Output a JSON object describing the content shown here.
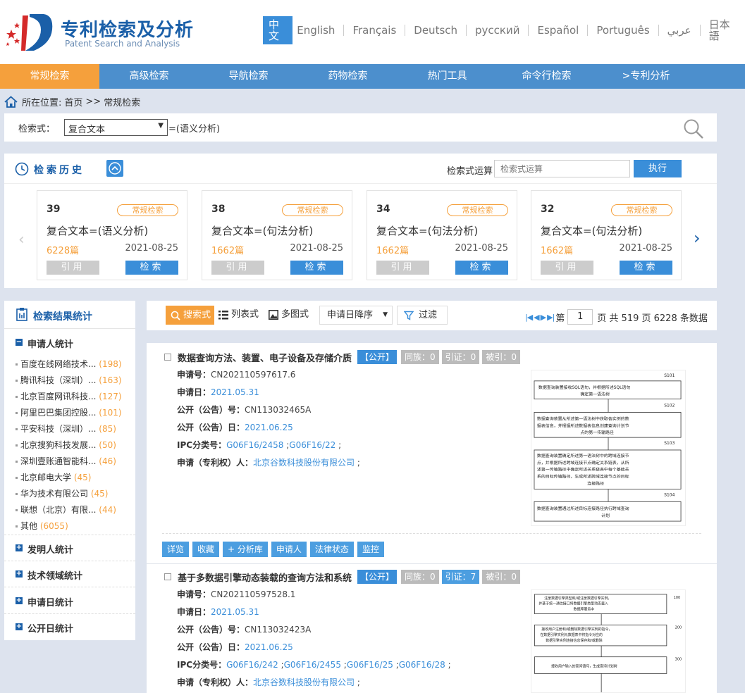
{
  "header": {
    "title": "专利检索及分析",
    "subtitle": "Patent Search and Analysis",
    "languages": [
      "中文",
      "English",
      "Français",
      "Deutsch",
      "русский",
      "Español",
      "Português",
      "عربي",
      "日本語"
    ]
  },
  "nav": {
    "items": [
      "常规检索",
      "高级检索",
      "导航检索",
      "药物检索",
      "热门工具",
      "命令行检索",
      ">专利分析"
    ]
  },
  "breadcrumb": {
    "label": "所在位置:",
    "home": "首页",
    "sep": ">>",
    "current": "常规检索"
  },
  "search": {
    "label": "检索式：",
    "selected": "复合文本",
    "suffix": "=(语义分析)"
  },
  "history": {
    "title": "检索历史",
    "op_label": "检索式运算",
    "op_placeholder": "检索式运算",
    "op_button": "执行",
    "cards": [
      {
        "num": "39",
        "tag": "常规检索",
        "expr": "复合文本=(语义分析)",
        "count": "6228篇",
        "date": "2021-08-25",
        "cite": "引用",
        "search": "检索"
      },
      {
        "num": "38",
        "tag": "常规检索",
        "expr": "复合文本=(句法分析)",
        "count": "1662篇",
        "date": "2021-08-25",
        "cite": "引用",
        "search": "检索"
      },
      {
        "num": "34",
        "tag": "常规检索",
        "expr": "复合文本=(句法分析)",
        "count": "1662篇",
        "date": "2021-08-25",
        "cite": "引用",
        "search": "检索"
      },
      {
        "num": "32",
        "tag": "常规检索",
        "expr": "复合文本=(句法分析)",
        "count": "1662篇",
        "date": "2021-08-25",
        "cite": "引用",
        "search": "检索"
      }
    ]
  },
  "stats": {
    "title": "检索结果统计",
    "applicant_title": "申请人统计",
    "applicants": [
      {
        "name": "百度在线网络技术...",
        "count": "(198)"
      },
      {
        "name": "腾讯科技（深圳）...",
        "count": "(163)"
      },
      {
        "name": "北京百度网讯科技...",
        "count": "(127)"
      },
      {
        "name": "阿里巴巴集团控股...",
        "count": "(101)"
      },
      {
        "name": "平安科技（深圳）...",
        "count": "(85)"
      },
      {
        "name": "北京搜狗科技发展...",
        "count": "(50)"
      },
      {
        "name": "深圳壹账通智能科...",
        "count": "(46)"
      },
      {
        "name": "北京邮电大学",
        "count": "(45)"
      },
      {
        "name": "华为技术有限公司",
        "count": "(45)"
      },
      {
        "name": "联想（北京）有限...",
        "count": "(44)"
      },
      {
        "name": "其他",
        "count": "(6055)"
      }
    ],
    "sections": [
      "发明人统计",
      "技术领域统计",
      "申请日统计",
      "公开日统计"
    ]
  },
  "toolbar": {
    "view_search": "搜索式",
    "view_list": "列表式",
    "view_image": "多图式",
    "sort": "申请日降序",
    "filter": "过滤",
    "page_prefix": "第",
    "page": "1",
    "page_suffix": "页 共 519 页 6228 条数据"
  },
  "results": [
    {
      "title": "数据查询方法、装置、电子设备及存储介质",
      "pub_badge": "【公开】",
      "family": "同族：0",
      "cited": "引证：0",
      "cited_by": "被引：0",
      "app_no_label": "申请号：",
      "app_no": "CN202110597617.6",
      "app_date_label": "申请日：",
      "app_date": "2021.05.31",
      "pub_no_label": "公开（公告）号：",
      "pub_no": "CN113032465A",
      "pub_date_label": "公开（公告）日：",
      "pub_date": "2021.06.25",
      "ipc_label": "IPC分类号：",
      "ipc": [
        "G06F16/2458",
        "G06F16/22"
      ],
      "applicant_label": "申请（专利权）人：",
      "applicant": "北京谷数科技股份有限公司",
      "diagram_steps": [
        {
          "id": "S101",
          "text": "数据查询装置接收SQL语句，并根据所述SQL语句确定第一语法树"
        },
        {
          "id": "S102",
          "text": "数据查询装置从所述第一语法树中获取各实例的数据表信息，并根据所述数据表信息创建查询计划节点的第一传输路径"
        },
        {
          "id": "S103",
          "text": "数据查询装置确定所述第一语法树中的跨域连接节点，并根据所述跨域连接节点确定关系链表，从所述第一传输路径中确定所述关系链表中每个基础关系的目标传输路径，生成所述跨域连接节点的目标连接路径"
        },
        {
          "id": "S104",
          "text": "数据查询装置通过所述目标连接路径执行跨域查询计划"
        }
      ],
      "actions": [
        "详览",
        "收藏",
        "+ 分析库",
        "申请人",
        "法律状态",
        "监控"
      ]
    },
    {
      "title": "基于多数据引擎动态装载的查询方法和系统",
      "pub_badge": "【公开】",
      "family": "同族：0",
      "cited": "引证：7",
      "cited_by": "被引：0",
      "app_no_label": "申请号：",
      "app_no": "CN202110597528.1",
      "app_date_label": "申请日：",
      "app_date": "2021.05.31",
      "pub_no_label": "公开（公告）号：",
      "pub_no": "CN113032423A",
      "pub_date_label": "公开（公告）日：",
      "pub_date": "2021.06.25",
      "ipc_label": "IPC分类号：",
      "ipc": [
        "G06F16/242",
        "G06F16/2455",
        "G06F16/25",
        "G06F16/28"
      ],
      "applicant_label": "申请（专利权）人：",
      "applicant": "北京谷数科技股份有限公司",
      "diagram_steps": [
        {
          "id": "100",
          "text": "注册数据引擎类型和/或注册数据引擎实例，并基于统一通信接口将数据引擎类型动态载入数据库服务中"
        },
        {
          "id": "200",
          "text": "接收用户注册和/或删除数据引擎实例的指令，在数据引擎实例元数据表中将指令对应的数据引擎实例连接信息保存和/或删除"
        },
        {
          "id": "300",
          "text": "接收用户输入的查询语句，生成查询计划树"
        }
      ]
    }
  ]
}
